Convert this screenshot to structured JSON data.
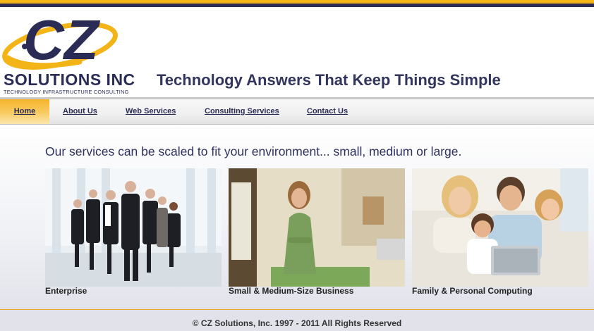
{
  "brand": {
    "logo_letters": "CZ",
    "name": "SOLUTIONS INC",
    "tagline_small": "TECHNOLOGY INFRASTRUCTURE CONSULTING",
    "headline": "Technology Answers That Keep Things Simple"
  },
  "nav": {
    "items": [
      {
        "label": "Home",
        "active": true
      },
      {
        "label": "About Us",
        "active": false
      },
      {
        "label": "Web Services",
        "active": false
      },
      {
        "label": "Consulting Services",
        "active": false
      },
      {
        "label": "Contact Us",
        "active": false
      }
    ]
  },
  "main": {
    "intro": "Our services can be scaled to fit your environment... small, medium or large.",
    "cards": [
      {
        "label": "Enterprise",
        "image": "business-team-photo"
      },
      {
        "label": "Small & Medium-Size Business",
        "image": "shop-owner-photo"
      },
      {
        "label": "Family & Personal Computing",
        "image": "family-laptop-photo"
      }
    ]
  },
  "footer": {
    "copyright": "© CZ Solutions, Inc. 1997 - 2011 All Rights Reserved"
  },
  "colors": {
    "navy": "#2a2c55",
    "gold": "#f2b417",
    "nav_active": "#f6b32b"
  }
}
